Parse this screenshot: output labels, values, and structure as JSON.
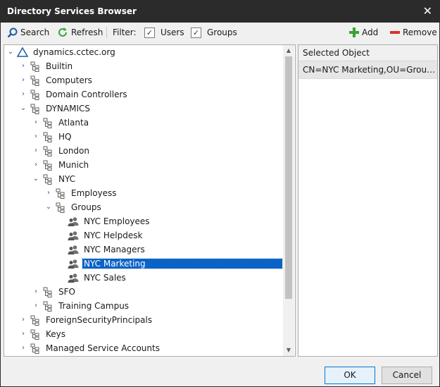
{
  "window": {
    "title": "Directory Services Browser"
  },
  "toolbar": {
    "search_label": "Search",
    "refresh_label": "Refresh",
    "filter_label": "Filter:",
    "users_label": "Users",
    "users_checked": true,
    "groups_label": "Groups",
    "groups_checked": true,
    "add_label": "Add",
    "remove_label": "Remove"
  },
  "tree": {
    "root": "dynamics.cctec.org",
    "items": [
      {
        "label": "Builtin"
      },
      {
        "label": "Computers"
      },
      {
        "label": "Domain Controllers"
      },
      {
        "label": "DYNAMICS"
      },
      {
        "label": "Atlanta"
      },
      {
        "label": "HQ"
      },
      {
        "label": "London"
      },
      {
        "label": "Munich"
      },
      {
        "label": "NYC"
      },
      {
        "label": "Employess"
      },
      {
        "label": "Groups"
      },
      {
        "label": "NYC Employees"
      },
      {
        "label": "NYC Helpdesk"
      },
      {
        "label": "NYC Managers"
      },
      {
        "label": "NYC Marketing"
      },
      {
        "label": "NYC Sales"
      },
      {
        "label": "SFO"
      },
      {
        "label": "Training Campus"
      },
      {
        "label": "ForeignSecurityPrincipals"
      },
      {
        "label": "Keys"
      },
      {
        "label": "Managed Service Accounts"
      }
    ],
    "selected": "NYC Marketing"
  },
  "right_panel": {
    "header": "Selected Object",
    "value": "CN=NYC Marketing,OU=Groups,OU=NYC,OU=DYNAMICS,DC=dynamics,DC=cctec,DC=org"
  },
  "buttons": {
    "ok": "OK",
    "cancel": "Cancel"
  },
  "colors": {
    "titlebar": "#2b2b2b",
    "selection": "#0a63c7",
    "accent": "#1e5aa8",
    "add": "#3aa335",
    "remove": "#d9342b"
  }
}
